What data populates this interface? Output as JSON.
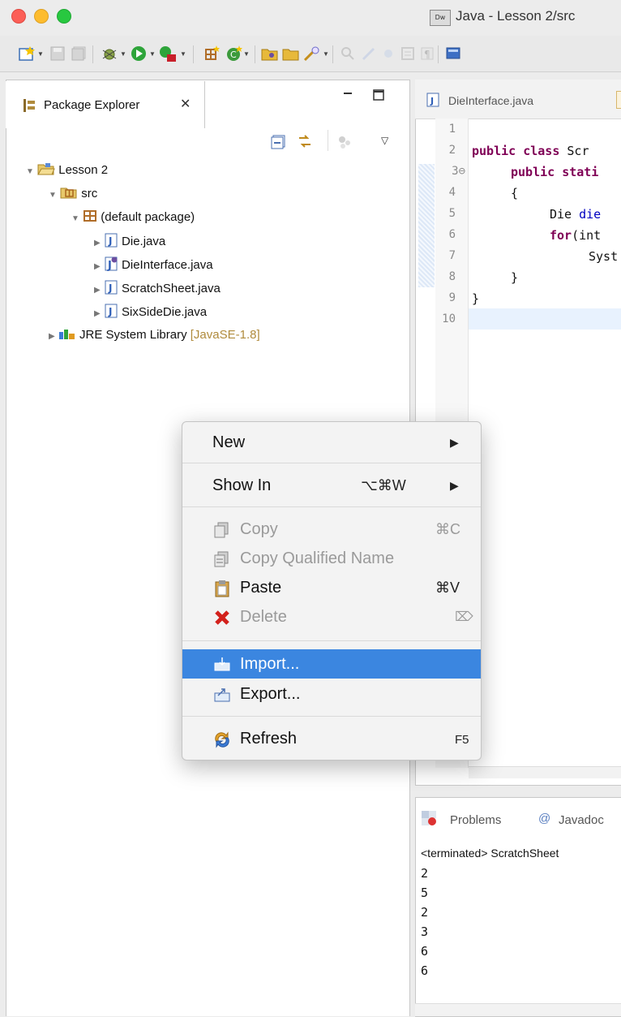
{
  "window": {
    "title": "Java - Lesson 2/src",
    "app_badge": "Dw"
  },
  "package_explorer": {
    "tab_label": "Package Explorer",
    "tree": {
      "project": "Lesson 2",
      "src": "src",
      "package": "(default package)",
      "files": [
        "Die.java",
        "DieInterface.java",
        "ScratchSheet.java",
        "SixSideDie.java"
      ],
      "jre": "JRE System Library",
      "jre_version": "[JavaSE-1.8]"
    }
  },
  "editor": {
    "tab_label": "DieInterface.java",
    "line_numbers": [
      "1",
      "2",
      "3⊖",
      "4",
      "5",
      "6",
      "7",
      "8",
      "9",
      "10"
    ],
    "code": {
      "line2_kw": "public class",
      "line2_rest": " Scr",
      "line3_kw": "public",
      "line3_kw2": "stati",
      "line4": "{",
      "line5_a": "Die ",
      "line5_b": "die",
      "line6_kw": "for",
      "line6_rest": "(int",
      "line7": "Syst",
      "line8": "}",
      "line9": "}"
    }
  },
  "console": {
    "tabs": {
      "problems": "Problems",
      "javadoc": "Javadoc"
    },
    "header": "<terminated> ScratchSheet",
    "output": [
      "2",
      "5",
      "2",
      "3",
      "6",
      "6"
    ]
  },
  "context_menu": {
    "new": "New",
    "show_in": "Show In",
    "show_in_shortcut": "⌥⌘W",
    "copy": "Copy",
    "copy_shortcut": "⌘C",
    "copy_qualified": "Copy Qualified Name",
    "paste": "Paste",
    "paste_shortcut": "⌘V",
    "delete": "Delete",
    "delete_shortcut": "⌦",
    "import": "Import...",
    "export": "Export...",
    "refresh": "Refresh",
    "refresh_shortcut": "F5"
  },
  "colors": {
    "selection": "#3b86e0",
    "keyword": "#7f0055",
    "jre_version": "#b08b3d"
  }
}
